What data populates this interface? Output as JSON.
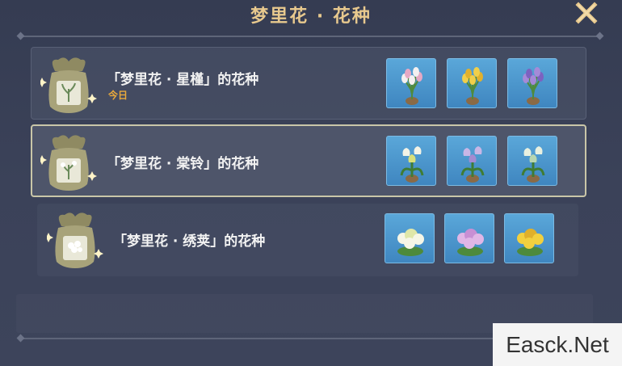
{
  "window": {
    "title": "梦里花 · 花种",
    "close_icon": "close-x-icon",
    "accent_color": "#e8c98e"
  },
  "seeds": [
    {
      "name": "「梦里花 · 星槿」的花种",
      "tag": "今日",
      "selected": false,
      "flowers": [
        {
          "icon": "white-pink-tulip-icon",
          "petal": "#f4f0f0",
          "accent": "#e6a9c4"
        },
        {
          "icon": "yellow-tulip-icon",
          "petal": "#f0cf4a",
          "accent": "#e0b12e"
        },
        {
          "icon": "purple-tulip-icon",
          "petal": "#a58ad8",
          "accent": "#7c62c0"
        }
      ]
    },
    {
      "name": "「梦里花 · 棠铃」的花种",
      "tag": "",
      "selected": true,
      "flowers": [
        {
          "icon": "white-bellflower-icon",
          "petal": "#f3f3e6",
          "accent": "#d8e07a"
        },
        {
          "icon": "lilac-bellflower-icon",
          "petal": "#c8b6e6",
          "accent": "#a48bd0"
        },
        {
          "icon": "pale-green-bellflower-icon",
          "petal": "#e8f0e0",
          "accent": "#b8d6b0"
        }
      ]
    },
    {
      "name": "「梦里花 · 绣荚」的花种",
      "tag": "",
      "selected": false,
      "flowers": [
        {
          "icon": "white-hydrangea-icon",
          "petal": "#f6f6e6",
          "accent": "#dfe7a8"
        },
        {
          "icon": "pink-hydrangea-icon",
          "petal": "#e1b6e6",
          "accent": "#c88fd4"
        },
        {
          "icon": "yellow-hydrangea-icon",
          "petal": "#f2d03e",
          "accent": "#e0b02a"
        }
      ]
    }
  ],
  "watermark": "Easck.Net"
}
